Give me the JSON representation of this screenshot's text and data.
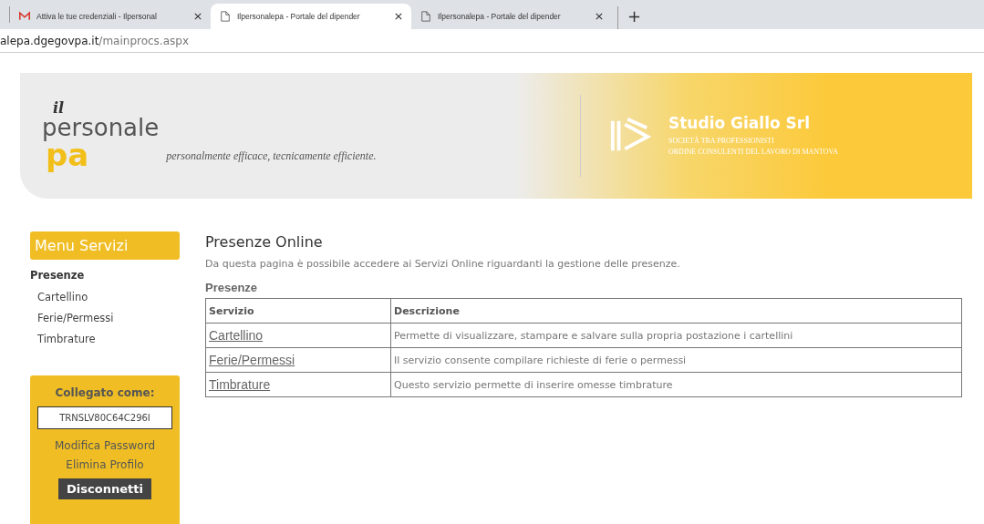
{
  "browser": {
    "tabs": [
      {
        "title": "Attiva le tue credenziali - Ilpersonal",
        "kind": "mail",
        "selected": false
      },
      {
        "title": "Ilpersonalepa - Portale del dipender",
        "kind": "page",
        "selected": true
      },
      {
        "title": "Ilpersonalepa - Portale del dipender",
        "kind": "page",
        "selected": false
      }
    ],
    "new_tab": "+",
    "address": {
      "host": "alepa.dgegovpa.it",
      "path": "/mainprocs.aspx"
    }
  },
  "banner": {
    "logo": {
      "top": "il",
      "middle": "personale",
      "bottom": "pa"
    },
    "tagline": "personalmente efficace, tecnicamente efficiente.",
    "company": "Studio Giallo Srl",
    "company_lines": [
      "SOCIETÀ TRA PROFESSIONISTI",
      "ORDINE CONSULENTI DEL LAVORO DI MANTOVA"
    ]
  },
  "sidebar": {
    "title": "Menu Servizi",
    "section": "Presenze",
    "items": [
      "Cartellino",
      "Ferie/Permessi",
      "Timbrature"
    ],
    "login": {
      "label": "Collegato come:",
      "user": "TRNSLV80C64C296I",
      "links": [
        "Modifica Password",
        "Elimina Profilo"
      ],
      "logout": "Disconnetti"
    }
  },
  "content": {
    "title": "Presenze Online",
    "intro": "Da questa pagina è possibile accedere ai Servizi Online riguardanti la gestione delle presenze.",
    "table_title": "Presenze",
    "columns": [
      "Servizio",
      "Descrizione"
    ],
    "rows": [
      {
        "service": "Cartellino",
        "description": "Permette di visualizzare, stampare e salvare sulla propria postazione i cartellini"
      },
      {
        "service": "Ferie/Permessi",
        "description": "Il servizio consente compilare richieste di ferie o permessi"
      },
      {
        "service": "Timbrature",
        "description": "Questo servizio permette di inserire omesse timbrature"
      }
    ]
  }
}
